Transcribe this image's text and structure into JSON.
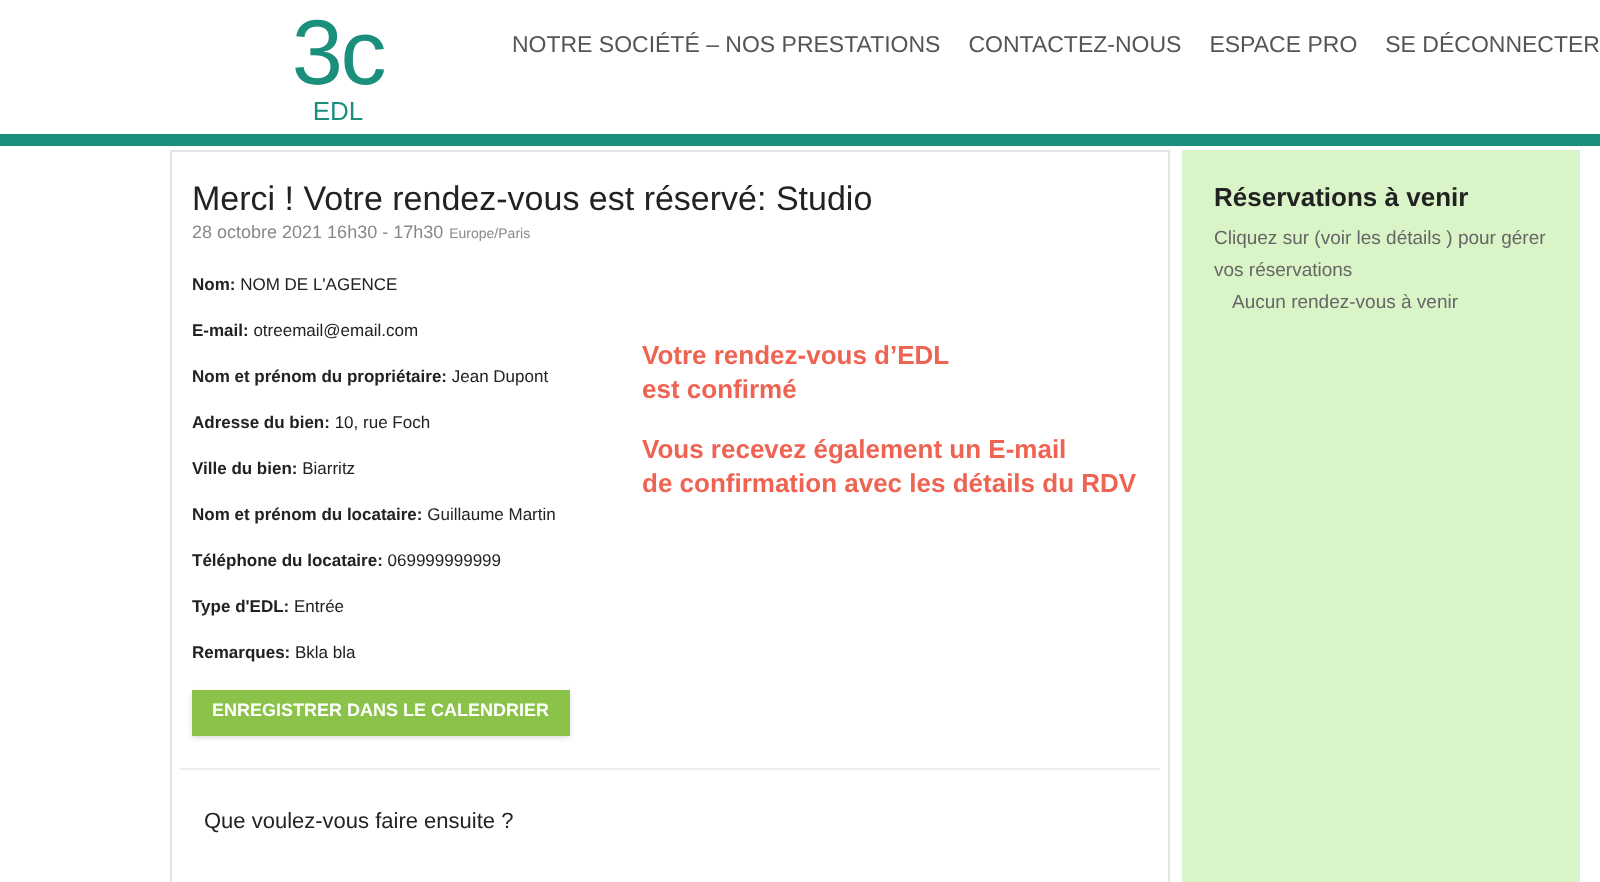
{
  "logo": {
    "mark": "3c",
    "sub": "EDL"
  },
  "nav": [
    "NOTRE SOCIÉTÉ – NOS PRESTATIONS",
    "CONTACTEZ-NOUS",
    "ESPACE PRO",
    "SE DÉCONNECTER"
  ],
  "confirmation": {
    "title": "Merci ! Votre rendez-vous est réservé: Studio",
    "date": "28 octobre 2021 16h30 - 17h30",
    "timezone": "Europe/Paris",
    "fields": [
      {
        "label": "Nom:",
        "value": "NOM DE L'AGENCE"
      },
      {
        "label": "E-mail:",
        "value": "otreemail@email.com"
      },
      {
        "label": "Nom et prénom du propriétaire:",
        "value": "Jean Dupont"
      },
      {
        "label": "Adresse du bien:",
        "value": "10, rue Foch"
      },
      {
        "label": "Ville du bien:",
        "value": "Biarritz"
      },
      {
        "label": "Nom et prénom du locataire:",
        "value": "Guillaume Martin"
      },
      {
        "label": "Téléphone du locataire:",
        "value": "069999999999"
      },
      {
        "label": "Type d'EDL:",
        "value": "Entrée"
      },
      {
        "label": "Remarques:",
        "value": "Bkla bla"
      }
    ],
    "notice": [
      [
        "Votre rendez-vous d’EDL",
        "est confirmé"
      ],
      [
        "Vous recevez également un E-mail",
        "de confirmation avec les détails du RDV"
      ]
    ],
    "button": "ENREGISTRER DANS LE CALENDRIER",
    "next": "Que voulez-vous faire ensuite ?"
  },
  "sidebar": {
    "title": "Réservations à venir",
    "text": "Cliquez sur (voir les détails ) pour gérer vos réservations",
    "empty": "Aucun rendez-vous à venir"
  }
}
